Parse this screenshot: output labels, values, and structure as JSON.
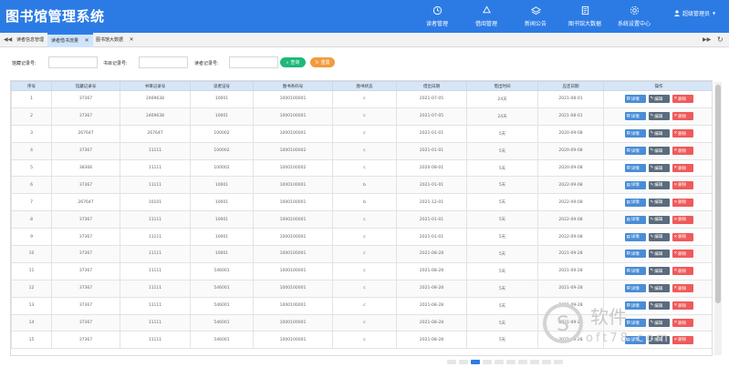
{
  "app": {
    "title": "图书馆管理系统"
  },
  "nav": [
    {
      "label": "读者管理",
      "icon": "refresh-icon"
    },
    {
      "label": "借阅管理",
      "icon": "recycle-icon"
    },
    {
      "label": "新闻公告",
      "icon": "layers-icon"
    },
    {
      "label": "图书馆大数据",
      "icon": "document-icon"
    },
    {
      "label": "系统设置中心",
      "icon": "gear-icon"
    }
  ],
  "user": {
    "name": "超级管理员"
  },
  "tabs": [
    {
      "label": "读者信息管理"
    },
    {
      "label": "读者借书流量"
    },
    {
      "label": "图书馆大数据"
    }
  ],
  "search": {
    "fields": [
      {
        "label": "馆藏记录号:",
        "value": ""
      },
      {
        "label": "书目记录号:",
        "value": ""
      },
      {
        "label": "读者记录号:",
        "value": ""
      }
    ],
    "query_label": "查询",
    "reset_label": "重置"
  },
  "table": {
    "headers": [
      "序号",
      "馆藏记录号",
      "书目记录号",
      "读者证号",
      "图书条码号",
      "图书状态",
      "借出日期",
      "借出时间",
      "应还日期",
      "操作"
    ],
    "ops": {
      "detail": "详情",
      "edit": "编辑",
      "delete": "删除"
    },
    "rows": [
      [
        "1",
        "37367",
        "2469638",
        "10001",
        "1000100001",
        "c",
        "2021-07-05",
        "24天",
        "2021-08-01"
      ],
      [
        "2",
        "37367",
        "2469638",
        "10001",
        "1000100001",
        "c",
        "2021-07-05",
        "24天",
        "2021-08-01"
      ],
      [
        "3",
        "267647",
        "267647",
        "100002",
        "1000100001",
        "c",
        "2021-01-01",
        "5天",
        "2020-09-08"
      ],
      [
        "4",
        "37367",
        "11111",
        "100002",
        "1000100002",
        "c",
        "2021-01-01",
        "5天",
        "2020-09-08"
      ],
      [
        "5",
        "38366",
        "11111",
        "100002",
        "1000100002",
        "c",
        "2020-08-01",
        "5天",
        "2020-09-08"
      ],
      [
        "6",
        "37367",
        "11111",
        "10001",
        "1000100001",
        "b",
        "2021-01-01",
        "5天",
        "2022-09-08"
      ],
      [
        "7",
        "267647",
        "10101",
        "10001",
        "1000100001",
        "b",
        "2021-12-01",
        "5天",
        "2022-09-08"
      ],
      [
        "8",
        "37367",
        "11111",
        "10001",
        "1000100001",
        "c",
        "2021-01-01",
        "5天",
        "2022-09-08"
      ],
      [
        "9",
        "37367",
        "11111",
        "10001",
        "1000100001",
        "c",
        "2021-01-01",
        "5天",
        "2022-09-08"
      ],
      [
        "10",
        "37367",
        "11111",
        "10001",
        "1000100001",
        "c",
        "2021-08-28",
        "5天",
        "2021-09-28"
      ],
      [
        "11",
        "37367",
        "11111",
        "546001",
        "1000100001",
        "c",
        "2021-08-28",
        "5天",
        "2021-09-28"
      ],
      [
        "12",
        "37367",
        "11111",
        "546001",
        "1000100001",
        "c",
        "2021-08-28",
        "5天",
        "2021-09-28"
      ],
      [
        "13",
        "37367",
        "11111",
        "546001",
        "1000100001",
        "c",
        "2021-08-28",
        "5天",
        "2021-09-28"
      ],
      [
        "14",
        "37367",
        "11111",
        "546001",
        "1000100001",
        "c",
        "2021-08-28",
        "5天",
        "2021-09-28"
      ],
      [
        "15",
        "37367",
        "11111",
        "546001",
        "1000100001",
        "c",
        "2021-08-28",
        "5天",
        "2021-09-28"
      ]
    ]
  },
  "watermark": {
    "line1": "软件",
    "line2": "oft78.com",
    "brand": "S"
  }
}
